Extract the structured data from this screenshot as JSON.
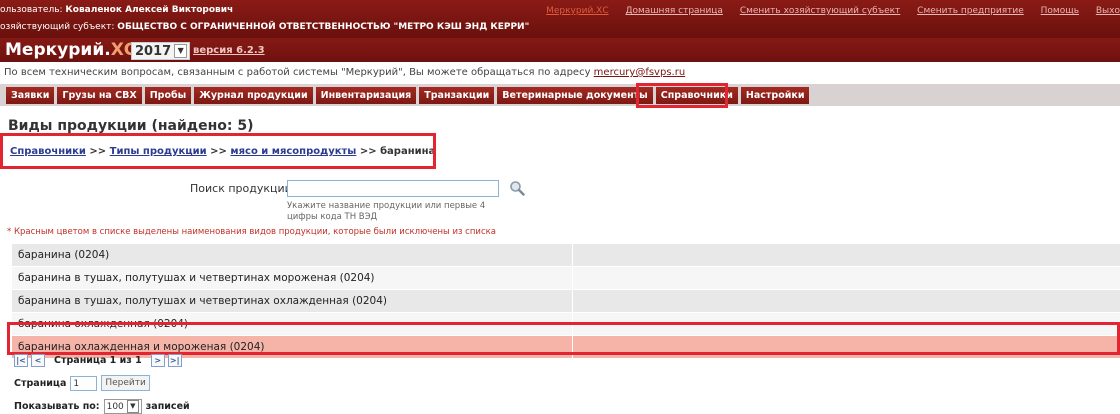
{
  "header": {
    "user_label": "ользователь:",
    "user_name": "Коваленок Алексей Викторович",
    "entity_label": "озяйствующий субъект:",
    "entity_name": "ОБЩЕСТВО С ОГРАНИЧЕННОЙ ОТВЕТСТВЕННОСТЬЮ \"МЕТРО КЭШ ЭНД КЕРРИ\"",
    "links": [
      "Меркурий.ХС",
      "Домашняя страница",
      "Сменить хозяйствующий субъект",
      "Сменить предприятие",
      "Помощь",
      "Выхо"
    ]
  },
  "brand": {
    "name": "Меркурий.",
    "suffix": "ХС",
    "year": "2017",
    "version": "версия 6.2.3"
  },
  "support": {
    "text": "По всем техническим вопросам, связанным с работой системы \"Меркурий\", Вы можете обращаться по адресу ",
    "email": "mercury@fsvps.ru"
  },
  "menu": [
    "Заявки",
    "Грузы на СВХ",
    "Пробы",
    "Журнал продукции",
    "Инвентаризация",
    "Транзакции",
    "Ветеринарные документы",
    "Справочники",
    "Настройки"
  ],
  "page": {
    "title": "Виды продукции (найдено: 5)"
  },
  "breadcrumb": {
    "c1": "Справочники",
    "sep": ">>",
    "c2": "Типы продукции",
    "c3": "мясо и мясопродукты",
    "c4": "баранина"
  },
  "search": {
    "label": "Поиск продукции:",
    "value": "",
    "hint1": "Укажите название продукции или первые 4",
    "hint2": "цифры кода ТН ВЭД"
  },
  "note": "* Красным цветом в списке выделены наименования видов продукции, которые были исключены из списка",
  "rows": [
    "баранина (0204)",
    "баранина в тушах, полутушах и четвертинах мороженая (0204)",
    "баранина в тушах, полутушах и четвертинах охлажденная (0204)",
    "баранина охлажденная (0204)",
    "баранина охлажденная и мороженая (0204)"
  ],
  "pager": {
    "first": "|<",
    "prev": "<",
    "text": "Страница 1 из 1",
    "next": ">",
    "last": ">|",
    "page_label": "Страница",
    "page_value": "1",
    "go_label": "Перейти",
    "show_label": "Показывать по:",
    "show_value": "100",
    "show_suffix": "записей"
  },
  "colors": {
    "brand": "#7a1512",
    "highlight": "#e32531",
    "excluded_row": "#f6b4a8"
  }
}
